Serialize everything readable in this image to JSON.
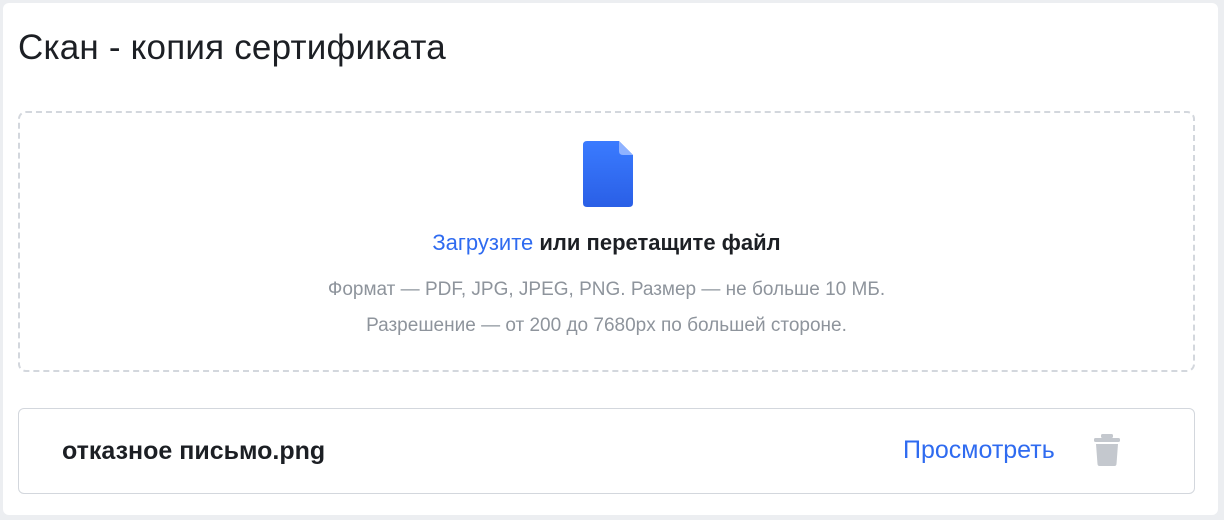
{
  "section": {
    "title": "Скан - копия сертификата"
  },
  "dropzone": {
    "upload_link": "Загрузите",
    "upload_text": " или перетащите файл",
    "format_hint": "Формат — PDF, JPG, JPEG, PNG. Размер — не больше 10 МБ.",
    "resolution_hint": "Разрешение — от 200 до 7680px по большей стороне.",
    "icon": "file-icon"
  },
  "file": {
    "name": "отказное письмо.png",
    "view_label": "Просмотреть",
    "delete_icon": "trash-icon"
  },
  "colors": {
    "accent": "#2f6bf0",
    "icon_blue": "#2f6bf0",
    "hint_gray": "#8e949c",
    "border": "#d3d7dd",
    "trash_gray": "#c4c8ce"
  }
}
